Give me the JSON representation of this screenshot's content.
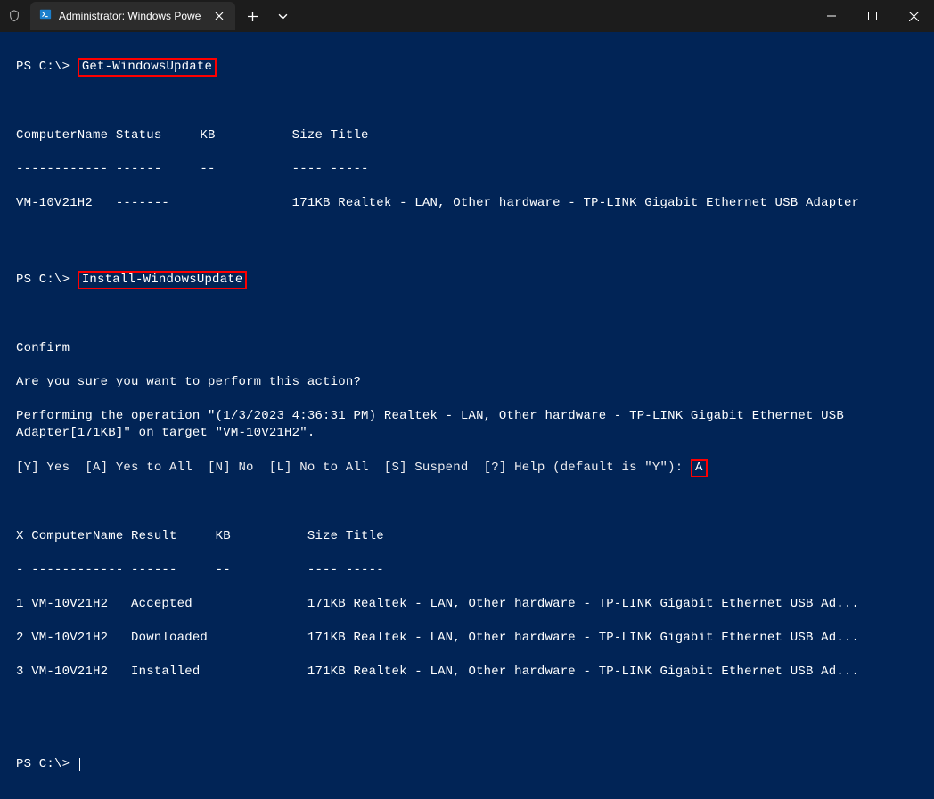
{
  "window": {
    "tab_title": "Administrator: Windows Powe"
  },
  "session": {
    "prompt": "PS C:\\>",
    "cmd1": "Get-WindowsUpdate",
    "cmd2": "Install-WindowsUpdate",
    "header_line": "ComputerName Status     KB          Size Title",
    "divider_line": "------------ ------     --          ---- -----",
    "get_result": "VM-10V21H2   -------                171KB Realtek - LAN, Other hardware - TP-LINK Gigabit Ethernet USB Adapter",
    "confirm_title": "Confirm",
    "confirm_q": "Are you sure you want to perform this action?",
    "confirm_op": "Performing the operation \"(1/3/2023 4:36:31 PM) Realtek - LAN, Other hardware - TP-LINK Gigabit Ethernet USB Adapter[171KB]\" on target \"VM-10V21H2\".",
    "choice_line": "[Y] Yes  [A] Yes to All  [N] No  [L] No to All  [S] Suspend  [?] Help (default is \"Y\"):",
    "answer": "A",
    "inst_header": "X ComputerName Result     KB          Size Title",
    "inst_divider": "- ------------ ------     --          ---- -----",
    "inst_row1": "1 VM-10V21H2   Accepted               171KB Realtek - LAN, Other hardware - TP-LINK Gigabit Ethernet USB Ad...",
    "inst_row2": "2 VM-10V21H2   Downloaded             171KB Realtek - LAN, Other hardware - TP-LINK Gigabit Ethernet USB Ad...",
    "inst_row3": "3 VM-10V21H2   Installed              171KB Realtek - LAN, Other hardware - TP-LINK Gigabit Ethernet USB Ad..."
  }
}
